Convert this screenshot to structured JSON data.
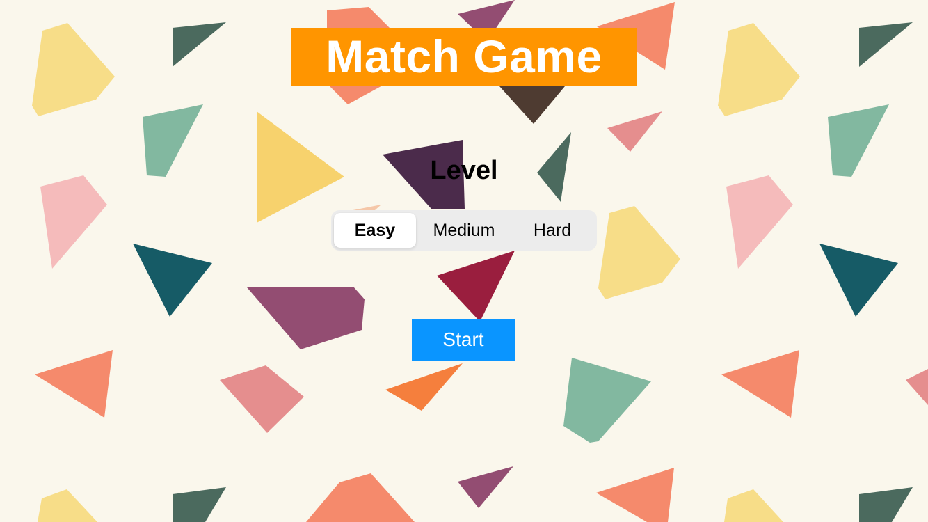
{
  "title": "Match Game",
  "level": {
    "label": "Level",
    "options": [
      "Easy",
      "Medium",
      "Hard"
    ],
    "selected": "Easy"
  },
  "start_label": "Start",
  "colors": {
    "background": "#faf7ec",
    "title_banner": "#ff9500",
    "start_button": "#0a95ff",
    "shapes": [
      "#f7dd88",
      "#4b6a5e",
      "#f58a6c",
      "#934d72",
      "#f7d26d",
      "#82b8a0",
      "#4e3b31",
      "#e58e8e",
      "#f5bbbb",
      "#4b2b4b",
      "#165b66",
      "#9a1e3e",
      "#f57f3d"
    ]
  },
  "background_pattern": "scattered-polygons"
}
